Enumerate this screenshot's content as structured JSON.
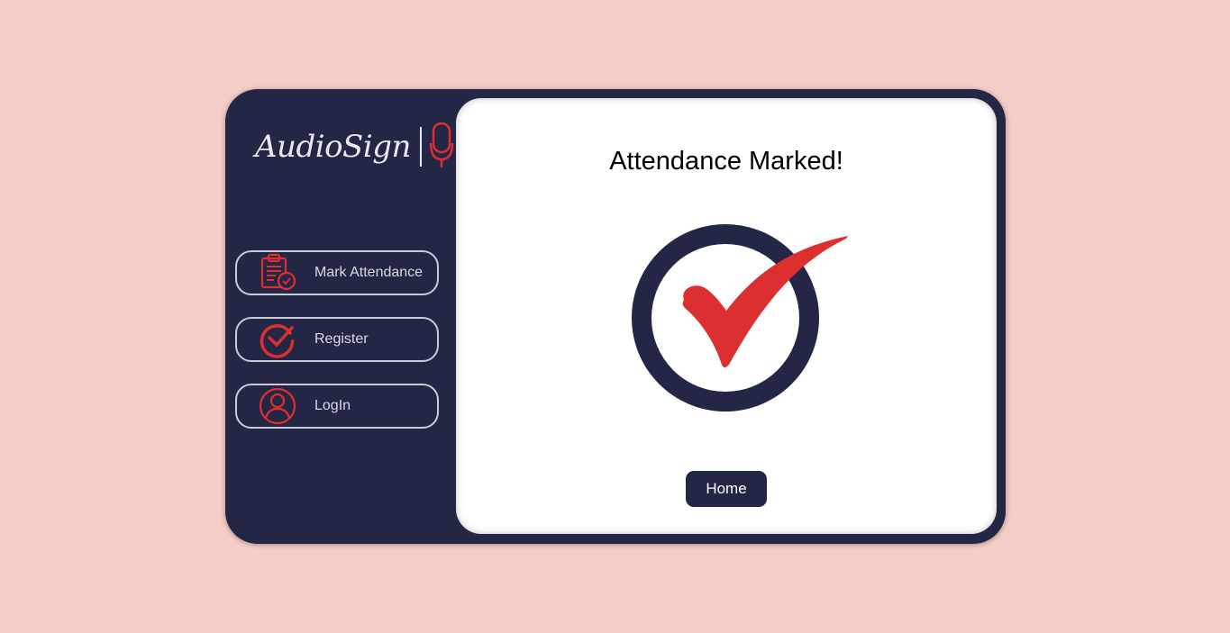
{
  "app": {
    "brand": "AudioSign",
    "accent_color": "#dc2f2f",
    "dark_color": "#242645",
    "background_color": "#f5cdc7"
  },
  "sidebar": {
    "items": [
      {
        "label": "Mark Attendance",
        "icon": "clipboard-check-icon"
      },
      {
        "label": "Register",
        "icon": "circle-check-icon"
      },
      {
        "label": "LogIn",
        "icon": "user-circle-icon"
      }
    ]
  },
  "main": {
    "title": "Attendance Marked!",
    "graphic_icon": "success-checkmark-icon",
    "home_button": "Home"
  }
}
